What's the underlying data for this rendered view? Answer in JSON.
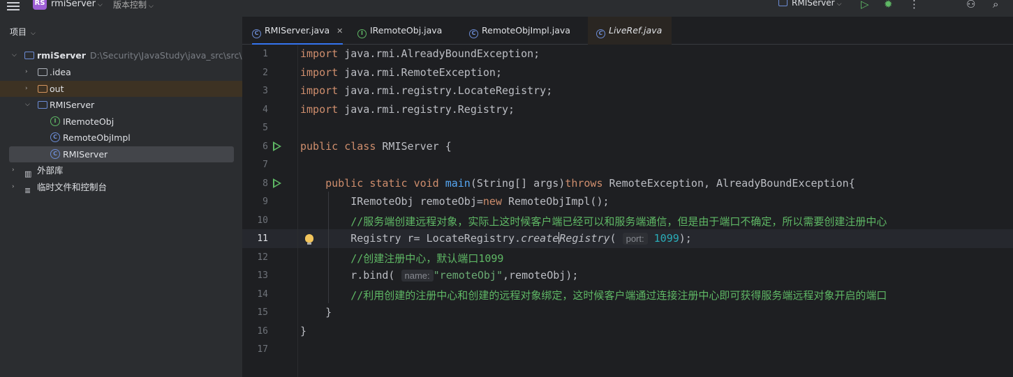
{
  "topbar": {
    "project_badge": "RS",
    "project_name": "rmiServer",
    "vcs_label": "版本控制",
    "run_config": "RMIServer"
  },
  "project_panel": {
    "header": "项目",
    "root_name": "rmiServer",
    "root_path": "D:\\Security\\JavaStudy\\java_src\\src\\m",
    "idea": ".idea",
    "out": "out",
    "pkg": "RMIServer",
    "iremote": "IRemoteObj",
    "remoteimpl": "RemoteObjImpl",
    "rmiserver": "RMIServer",
    "ext_lib": "外部库",
    "scratch": "临时文件和控制台"
  },
  "tabs": [
    {
      "label": "RMIServer.java",
      "icon": "C"
    },
    {
      "label": "IRemoteObj.java",
      "icon": "I"
    },
    {
      "label": "RemoteObjImpl.java",
      "icon": "C"
    },
    {
      "label": "LiveRef.java",
      "icon": "C"
    }
  ],
  "code": {
    "l1": "java.rmi.AlreadyBoundException;",
    "l2": "java.rmi.RemoteException;",
    "l3": "java.rmi.registry.LocateRegistry;",
    "l4": "java.rmi.registry.Registry;",
    "l6_name": "RMIServer {",
    "l8_sig": "(String[] args)",
    "l8_throws": " RemoteException, AlreadyBoundException{",
    "l9": "IRemoteObj remoteObj=",
    "l9_b": " RemoteObjImpl();",
    "l10": "//服务端创建远程对象，实际上这时候客户端已经可以和服务端通信，但是由于端口不确定，所以需要创建注册中心",
    "l11_a": "Registry r= LocateRegistry.",
    "l11_m1": "create",
    "l11_m2": "Registry",
    "l11_hint": "port:",
    "l11_num": "1099",
    "l12": "//创建注册中心，默认端口1099",
    "l13_a": "r.bind(",
    "l13_hint": "name:",
    "l13_str": "\"remoteObj\"",
    "l13_b": ",remoteObj);",
    "l14": "//利用创建的注册中心和创建的远程对象绑定，这时候客户端通过连接注册中心即可获得服务端远程对象开启的端口",
    "kw_import": "import",
    "kw_public": "public",
    "kw_class": "class",
    "kw_static": "static",
    "kw_void": "void",
    "kw_new": "new",
    "kw_throws": "throws",
    "fn_main": "main",
    "brace_close": "}",
    "paren_close": ");"
  },
  "line_numbers": [
    "1",
    "2",
    "3",
    "4",
    "5",
    "6",
    "7",
    "8",
    "9",
    "10",
    "11",
    "12",
    "13",
    "14",
    "15",
    "16",
    "17"
  ]
}
